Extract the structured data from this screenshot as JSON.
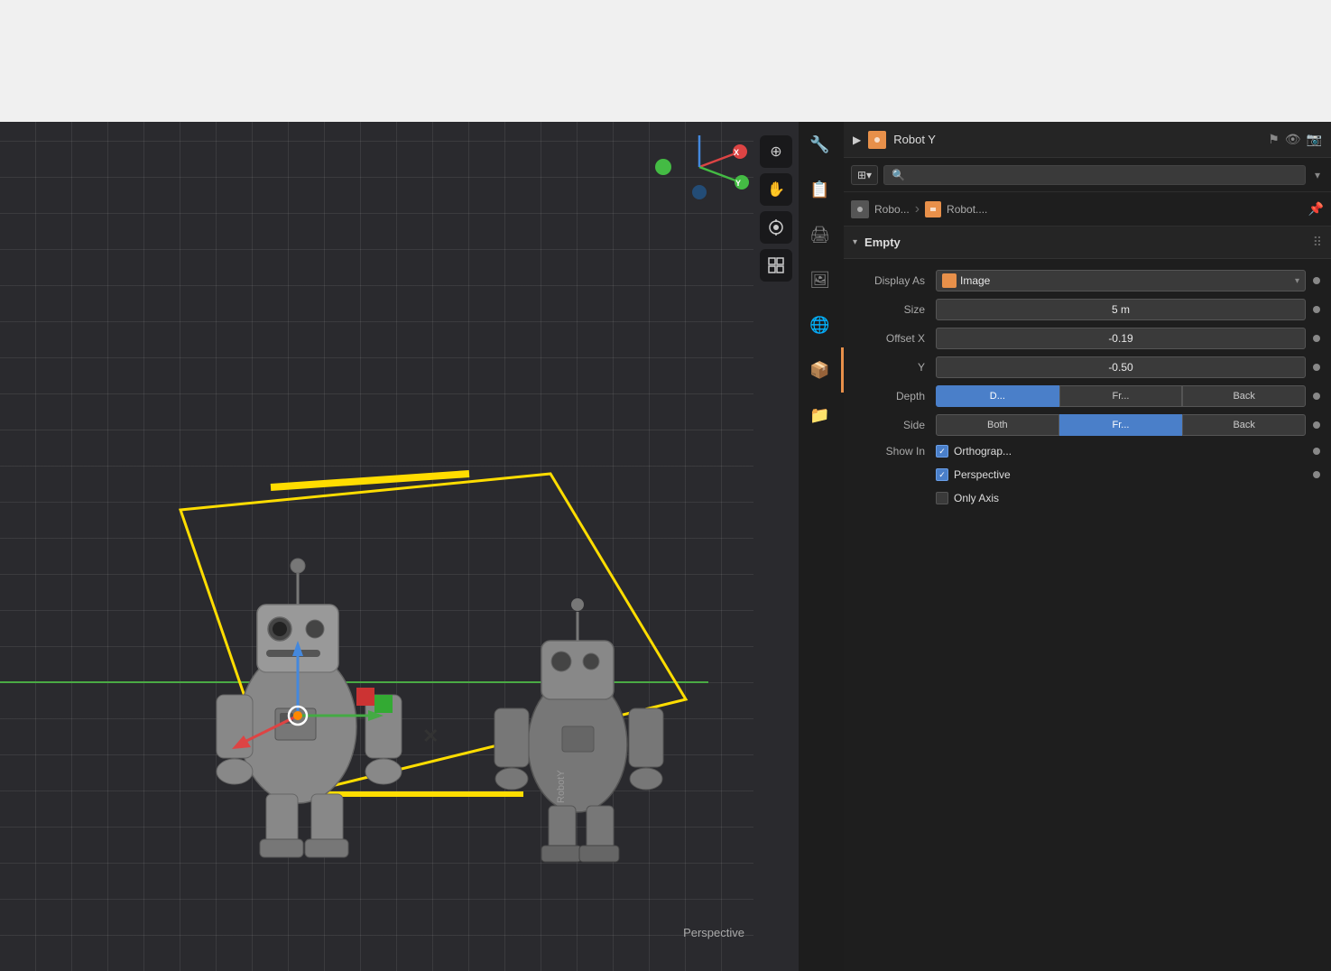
{
  "topBar": {
    "background": "#f0f0f0"
  },
  "viewport": {
    "perspectiveLabel": "Perspective",
    "gizmo": {
      "x_label": "X",
      "y_label": "Y",
      "dots": [
        "red",
        "green",
        "blue",
        "orange",
        "blue-hollow"
      ]
    }
  },
  "toolbar": {
    "buttons": [
      {
        "icon": "⊕",
        "name": "zoom-in",
        "title": "Add"
      },
      {
        "icon": "✋",
        "name": "pan",
        "title": "Pan"
      },
      {
        "icon": "🎬",
        "name": "camera",
        "title": "Camera"
      },
      {
        "icon": "⊞",
        "name": "grid",
        "title": "Grid"
      }
    ]
  },
  "sidebarIcons": [
    {
      "icon": "🔧",
      "name": "tool",
      "active": false
    },
    {
      "icon": "📋",
      "name": "scene",
      "active": false
    },
    {
      "icon": "🖨",
      "name": "output",
      "active": false
    },
    {
      "icon": "🖼",
      "name": "view-layer",
      "active": false
    },
    {
      "icon": "🌐",
      "name": "world",
      "active": false
    },
    {
      "icon": "📦",
      "name": "object",
      "active": true
    },
    {
      "icon": "📁",
      "name": "modifiers",
      "active": false
    }
  ],
  "panel": {
    "header": {
      "title": "Robot Y",
      "playLabel": "▶"
    },
    "searchPlaceholder": "🔍",
    "breadcrumb": {
      "left": "Robo...",
      "right": "Robot...."
    },
    "empty": {
      "title": "Empty",
      "displayAs": "Image",
      "size": "5 m",
      "offsetX": "-0.19",
      "offsetY": "-0.50",
      "depth": {
        "default_label": "D...",
        "front_label": "Fr...",
        "back_label": "Back"
      },
      "side": {
        "both_label": "Both",
        "front_label": "Fr...",
        "back_label": "Back"
      },
      "showIn": {
        "label": "Show In",
        "orthographic": "Orthograp...",
        "perspective": "Perspective",
        "onlyAxis": "Only Axis"
      }
    }
  }
}
